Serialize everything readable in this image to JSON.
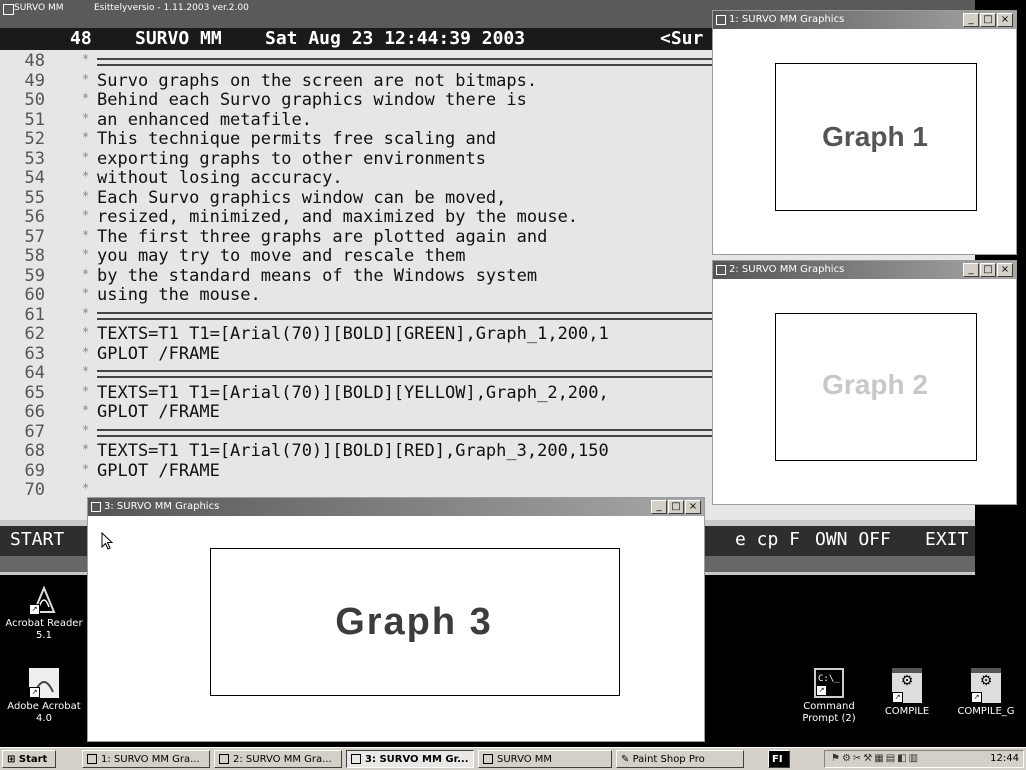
{
  "survo": {
    "title_app": "SURVO MM",
    "title_version": "Esittelyversio - 1.11.2003 ver.2.00",
    "header": {
      "line_number": "48",
      "app_label": "SURVO MM",
      "datetime": "Sat Aug 23 12:44:39 2003",
      "right_text": "<Sur"
    },
    "lines": [
      {
        "n": "48",
        "text": "",
        "sep": true
      },
      {
        "n": "49",
        "text": "Survo graphs on the screen are not bitmaps."
      },
      {
        "n": "50",
        "text": "Behind each Survo graphics window there is"
      },
      {
        "n": "51",
        "text": "an enhanced metafile."
      },
      {
        "n": "52",
        "text": "This technique permits free scaling and"
      },
      {
        "n": "53",
        "text": "exporting graphs to other environments"
      },
      {
        "n": "54",
        "text": "without losing accuracy."
      },
      {
        "n": "55",
        "text": "Each Survo graphics window can be moved,"
      },
      {
        "n": "56",
        "text": "resized, minimized, and maximized by the mouse."
      },
      {
        "n": "57",
        "text": "The first three graphs are plotted again and"
      },
      {
        "n": "58",
        "text": "you may try to move and rescale them"
      },
      {
        "n": "59",
        "text": "by the standard means of the Windows system"
      },
      {
        "n": "60",
        "text": "using the mouse."
      },
      {
        "n": "61",
        "text": "",
        "sep": true
      },
      {
        "n": "62",
        "text": "TEXTS=T1 T1=[Arial(70)][BOLD][GREEN],Graph_1,200,1"
      },
      {
        "n": "63",
        "text": "GPLOT /FRAME"
      },
      {
        "n": "64",
        "text": "",
        "sep": true
      },
      {
        "n": "65",
        "text": "TEXTS=T1 T1=[Arial(70)][BOLD][YELLOW],Graph_2,200,"
      },
      {
        "n": "66",
        "text": "GPLOT /FRAME"
      },
      {
        "n": "67",
        "text": "",
        "sep": true
      },
      {
        "n": "68",
        "text": "TEXTS=T1 T1=[Arial(70)][BOLD][RED],Graph_3,200,150"
      },
      {
        "n": "69",
        "text": "GPLOT /FRAME"
      },
      {
        "n": "70",
        "text": ""
      }
    ],
    "keys": {
      "start": "START",
      "right": "e cp F",
      "own_off": "OWN OFF",
      "exit": "EXIT"
    }
  },
  "graph_windows": [
    {
      "title": "1: SURVO MM Graphics",
      "label": "Graph 1",
      "label_color": "#555555"
    },
    {
      "title": "2: SURVO MM Graphics",
      "label": "Graph 2",
      "label_color": "#c8c8c8"
    },
    {
      "title": "3: SURVO MM Graphics",
      "label": "Graph 3",
      "label_color": "#3c3c3c"
    }
  ],
  "window_buttons": {
    "minimize": "_",
    "maximize": "□",
    "close": "×"
  },
  "desktop_icons": [
    {
      "label": "Acrobat Reader 5.1",
      "icon": "acrobat-reader-icon"
    },
    {
      "label": "Adobe Acrobat 4.0",
      "icon": "adobe-acrobat-icon"
    },
    {
      "label": "Command Prompt (2)",
      "icon": "command-prompt-icon"
    },
    {
      "label": "COMPILE",
      "icon": "compile-icon"
    },
    {
      "label": "COMPILE_G",
      "icon": "compile-g-icon"
    }
  ],
  "taskbar": {
    "start": "Start",
    "buttons": [
      {
        "label": "1: SURVO MM Gra...",
        "active": false
      },
      {
        "label": "2: SURVO MM Gra...",
        "active": false
      },
      {
        "label": "3: SURVO MM Gr...",
        "active": true
      },
      {
        "label": "SURVO MM",
        "active": false
      },
      {
        "label": "Paint Shop Pro",
        "active": false
      }
    ],
    "lang": "FI",
    "clock": "12:44"
  }
}
